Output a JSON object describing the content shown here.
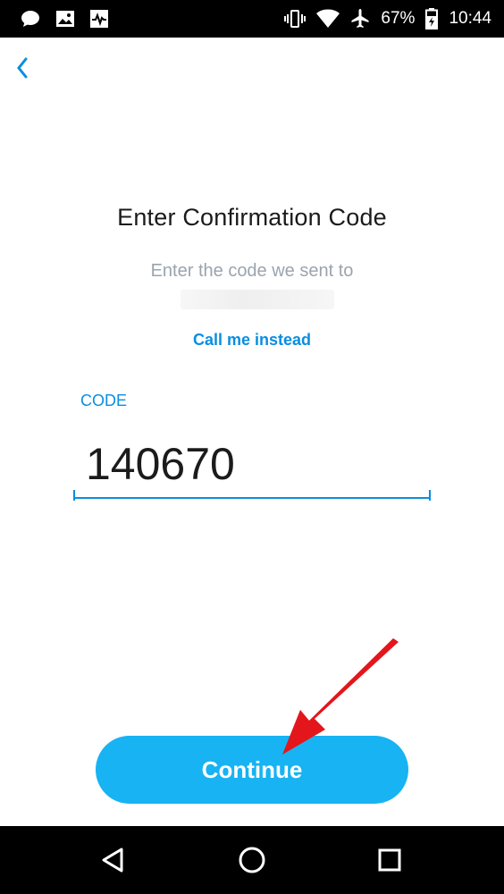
{
  "status_bar": {
    "battery_percent": "67%",
    "time": "10:44"
  },
  "screen": {
    "title": "Enter Confirmation Code",
    "subtitle": "Enter the code we sent to",
    "call_link": "Call me instead",
    "code_label": "CODE",
    "code_value": "140670",
    "continue_label": "Continue"
  },
  "colors": {
    "accent": "#0a8ee0",
    "button": "#17b3f2",
    "annotation_arrow": "#e3161c"
  },
  "icons": [
    "message-icon",
    "image-icon",
    "activity-icon",
    "vibrate-icon",
    "wifi-icon",
    "airplane-icon",
    "battery-icon",
    "back-chevron-icon",
    "nav-back-icon",
    "nav-home-icon",
    "nav-recents-icon"
  ]
}
